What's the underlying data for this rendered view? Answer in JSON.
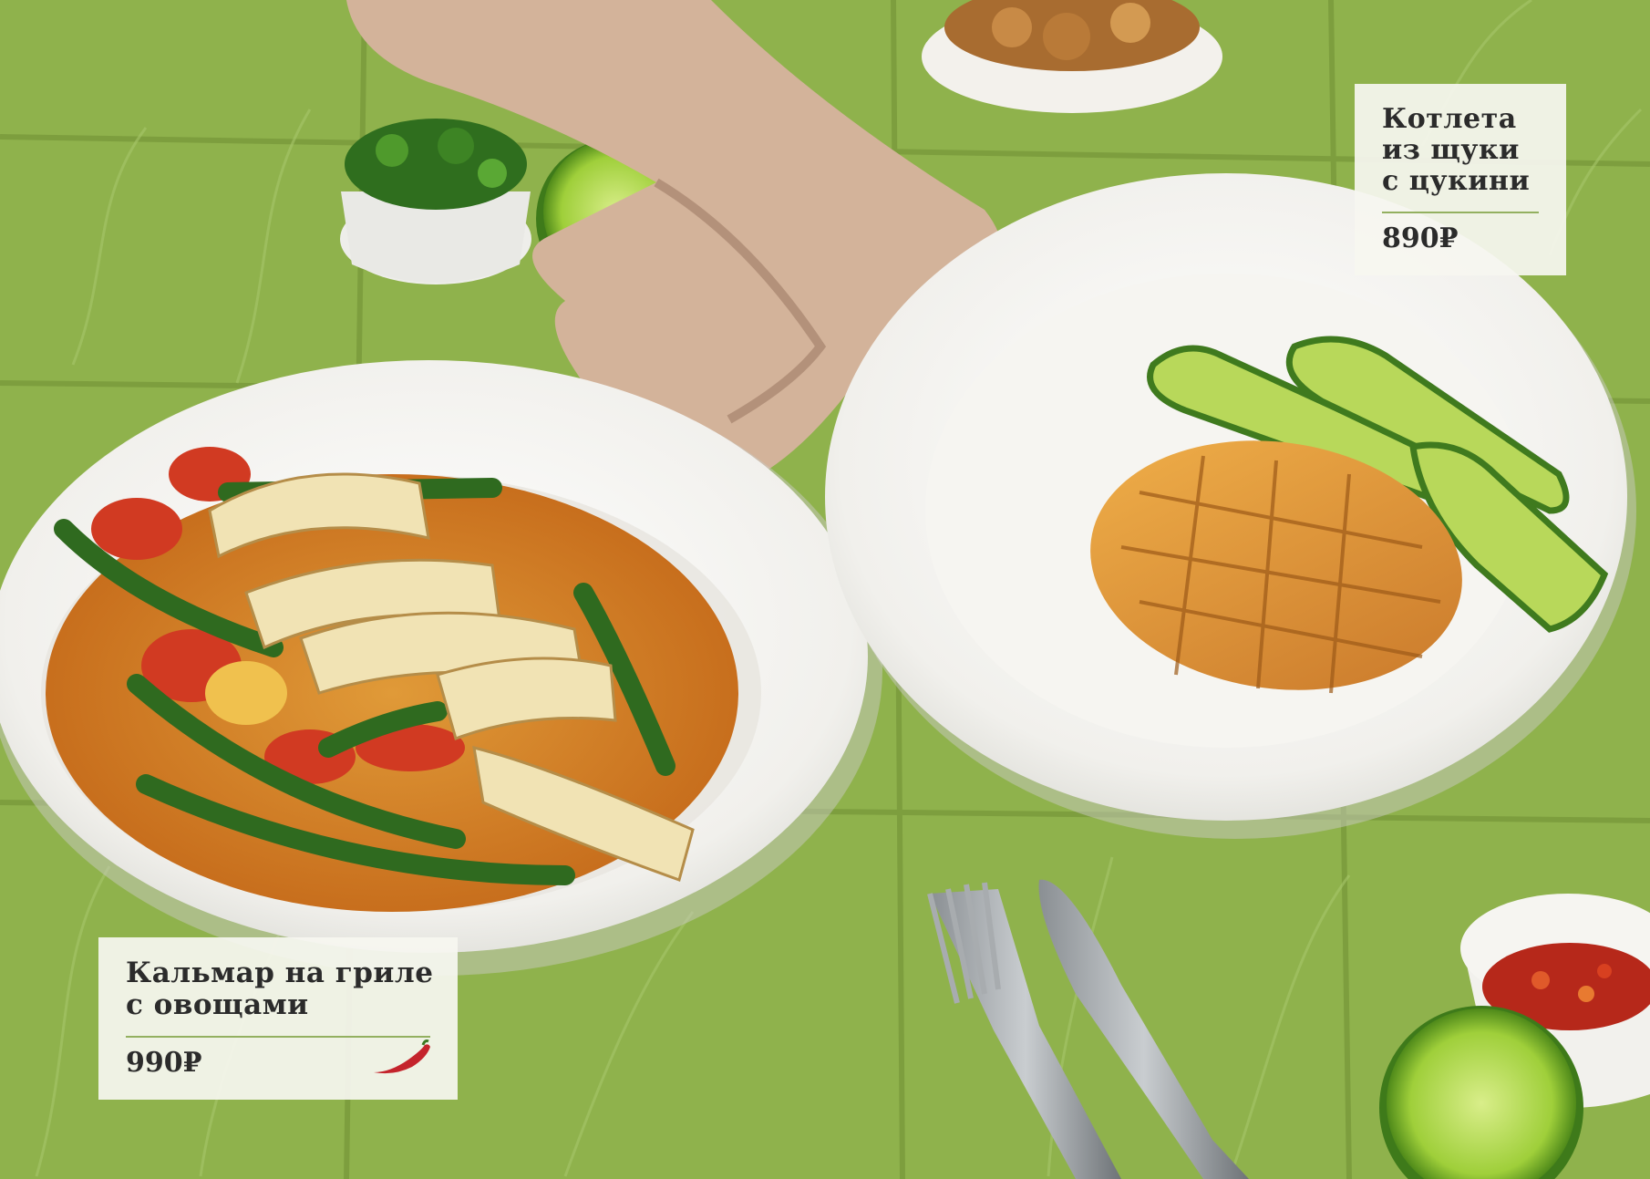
{
  "colors": {
    "background": "#8fb24c",
    "tile_dark": "#7c9c3c",
    "plate": "#f3f2ee",
    "card": "#f6f6f0",
    "card_rule": "#93b060",
    "chili": "#c4242c",
    "text": "#2b2b2b"
  },
  "icons": {
    "chili": "chili-pepper-icon"
  },
  "dishes": [
    {
      "name": "Кальмар на гриле\nс овощами",
      "price": "990₽",
      "spicy": true
    },
    {
      "name": "Котлета\nиз щуки\nс цукини",
      "price": "890₽",
      "spicy": false
    }
  ]
}
